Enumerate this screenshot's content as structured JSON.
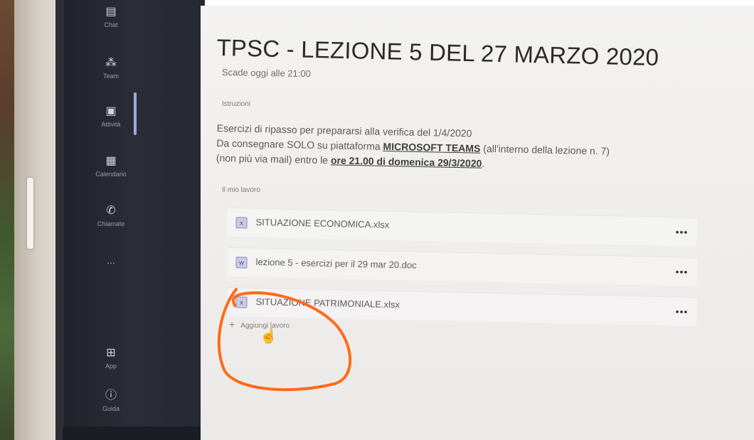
{
  "rail": {
    "items": [
      {
        "label": "Chat",
        "icon": "chat-icon",
        "glyph": "▤"
      },
      {
        "label": "Team",
        "icon": "teams-icon",
        "glyph": "⁂"
      },
      {
        "label": "Attività",
        "icon": "assignments-icon",
        "glyph": "▣"
      },
      {
        "label": "Calendario",
        "icon": "calendar-icon",
        "glyph": "▦"
      },
      {
        "label": "Chiamate",
        "icon": "phone-icon",
        "glyph": "✆"
      }
    ],
    "more": "...",
    "apps_label": "App",
    "help_label": "Guida"
  },
  "assignment": {
    "title": "TPSC - LEZIONE 5 DEL 27 MARZO 2020",
    "due": "Scade oggi alle 21:00",
    "instructions_heading": "Istruzioni",
    "instructions_line1": "Esercizi di ripasso per prepararsi alla verifica del 1/4/2020",
    "instructions_line2a": "Da consegnare SOLO su piattaforma ",
    "instructions_line2b": "MICROSOFT TEAMS",
    "instructions_line2c": " (all'interno della lezione n. 7)",
    "instructions_line3a": "(non più via mail) entro le ",
    "instructions_line3b": "ore 21.00 di domenica 29/3/2020",
    "instructions_line3c": ".",
    "my_work_heading": "Il mio lavoro",
    "files": [
      {
        "name": "SITUAZIONE ECONOMICA.xlsx"
      },
      {
        "name": "lezione 5 - esercizi per il 29 mar 20.doc"
      },
      {
        "name": "SITUAZIONE PATRIMONIALE.xlsx"
      }
    ],
    "file_more": "•••",
    "add_work": "Aggiungi lavoro"
  },
  "colors": {
    "annotation": "#ff6a1a",
    "rail_bg": "#262934"
  }
}
